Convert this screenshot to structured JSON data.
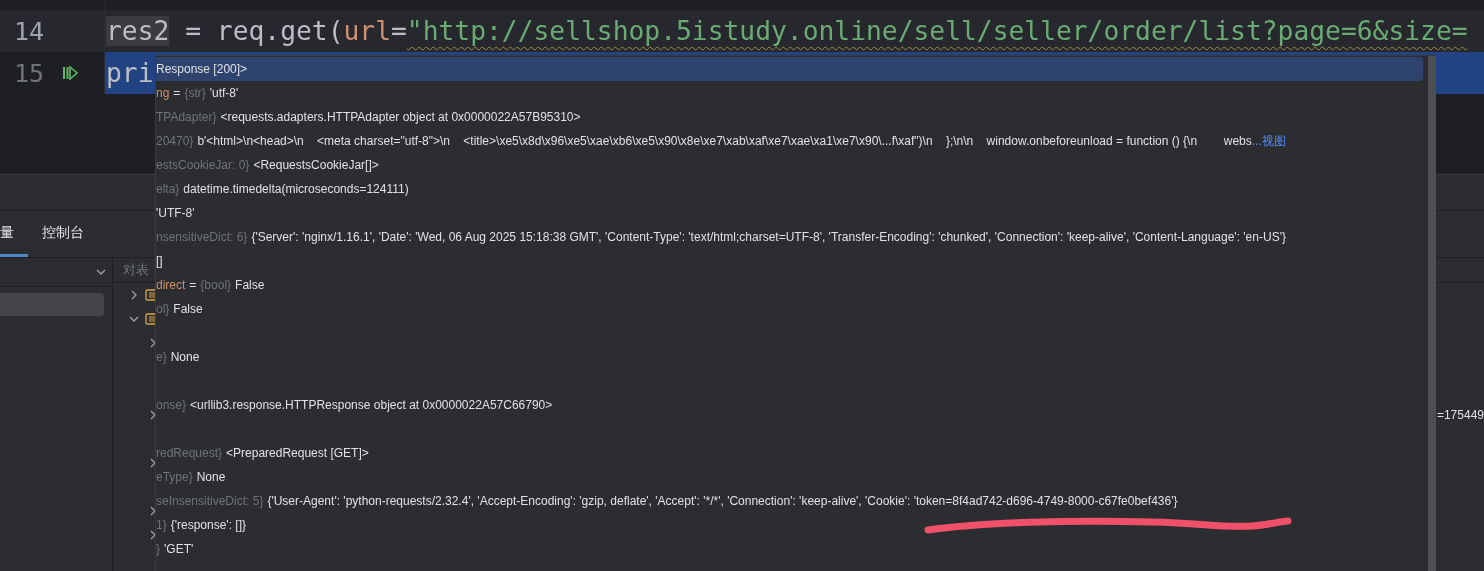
{
  "editor": {
    "lines": [
      {
        "number": "14",
        "current": true,
        "selected": false,
        "tokens": [
          {
            "text": "res2",
            "kind": "highlight"
          },
          {
            "text": " = req.get(",
            "kind": "plain"
          },
          {
            "text": "url",
            "kind": "param"
          },
          {
            "text": "=",
            "kind": "plain"
          },
          {
            "text": "\"http://sellshop.5istudy.online/sell/seller/order/list?page=6&size=",
            "kind": "string"
          }
        ]
      },
      {
        "number": "15",
        "current": false,
        "selected": true,
        "execution_point": true,
        "tokens": [
          {
            "text": "pri",
            "kind": "plain"
          }
        ]
      }
    ]
  },
  "tool_panel": {
    "tabs": [
      {
        "label": "量",
        "selected": true
      },
      {
        "label": "控制台",
        "selected": false
      }
    ],
    "column_header": "对表",
    "frames": [
      {
        "selected": true
      }
    ],
    "variables": [
      {
        "kind": "node",
        "expanded": false
      },
      {
        "kind": "node",
        "expanded": true,
        "children": [
          {
            "kind": "node",
            "expanded": false
          },
          {
            "kind": "leaf"
          },
          {
            "kind": "leaf"
          },
          {
            "kind": "node",
            "expanded": false,
            "value": "=175449"
          },
          {
            "kind": "leaf"
          },
          {
            "kind": "node",
            "expanded": false
          },
          {
            "kind": "leaf"
          },
          {
            "kind": "node",
            "expanded": false
          },
          {
            "kind": "node",
            "expanded": false
          },
          {
            "kind": "leaf"
          }
        ]
      }
    ]
  },
  "popup": {
    "rows": [
      {
        "selected": true,
        "value": "Response [200]>"
      },
      {
        "selected": false,
        "name": "ng",
        "operator": "=",
        "type": "{str}",
        "value": "'utf-8'"
      },
      {
        "selected": false,
        "type": "TPAdapter}",
        "value": "<requests.adapters.HTTPAdapter object at 0x0000022A57B95310>"
      },
      {
        "selected": false,
        "type": "20470}",
        "value": "b'<html>\\n<head>\\n    <meta charset=\"utf-8\">\\n    <title>\\xe5\\x8d\\x96\\xe5\\xae\\xb6\\xe5\\x90\\x8e\\xe7\\xab\\xaf\\xe7\\xae\\xa1\\xe7\\x90\\...f\\xaf\")\\n    };\\n\\n    window.onbeforeunload = function () {\\n        webs",
        "link": "...视图"
      },
      {
        "selected": false,
        "type": "estsCookieJar: 0}",
        "value": "<RequestsCookieJar[]>"
      },
      {
        "selected": false,
        "type": "elta}",
        "value": "datetime.timedelta(microseconds=124111)"
      },
      {
        "selected": false,
        "value": "'UTF-8'"
      },
      {
        "selected": false,
        "type": "nsensitiveDict: 6}",
        "value": "{'Server': 'nginx/1.16.1', 'Date': 'Wed, 06 Aug 2025 15:18:38 GMT', 'Content-Type': 'text/html;charset=UTF-8', 'Transfer-Encoding': 'chunked', 'Connection': 'keep-alive', 'Content-Language': 'en-US'}"
      },
      {
        "selected": false,
        "value": "[]"
      },
      {
        "selected": false,
        "name": "direct",
        "operator": "=",
        "type": "{bool}",
        "value": "False"
      },
      {
        "selected": false,
        "type": "ol}",
        "value": "False"
      },
      {
        "selected": false
      },
      {
        "selected": false,
        "type": "e}",
        "value": "None"
      },
      {
        "selected": false
      },
      {
        "selected": false,
        "type": "onse}",
        "value": "<urllib3.response.HTTPResponse object at 0x0000022A57C66790>"
      },
      {
        "selected": false
      },
      {
        "selected": false,
        "type": "redRequest}",
        "value": "<PreparedRequest [GET]>"
      },
      {
        "selected": false,
        "type": "eType}",
        "value": "None"
      },
      {
        "selected": false,
        "type": "seInsensitiveDict: 5}",
        "value": "{'User-Agent': 'python-requests/2.32.4', 'Accept-Encoding': 'gzip, deflate', 'Accept': '*/*', 'Connection': 'keep-alive', 'Cookie': 'token=8f4ad742-d696-4749-8000-c67fe0bef436'}"
      },
      {
        "selected": false,
        "type": "1}",
        "value": "{'response': []}"
      },
      {
        "selected": false,
        "type": "}",
        "value": "'GET'"
      }
    ],
    "annotation": {
      "kind": "underline",
      "color": "#f0506a"
    }
  }
}
